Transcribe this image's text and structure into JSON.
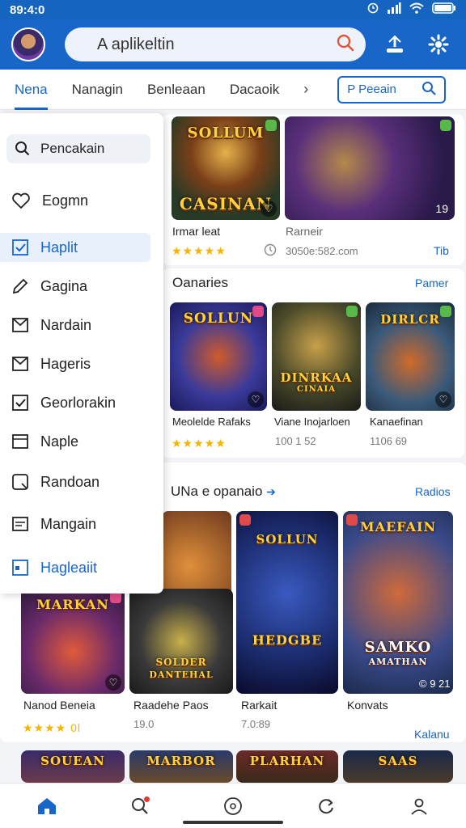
{
  "status": {
    "time": "89:4:0"
  },
  "header": {
    "search_text": "A aplikeltin"
  },
  "tabs": {
    "items": [
      "Nena",
      "Nanagin",
      "Benleaan",
      "Dacaoik"
    ],
    "more": "›",
    "search_label": "P Peeain"
  },
  "drawer": {
    "search": "Pencakain",
    "items": [
      {
        "label": "Eogmn",
        "icon": "heart-icon"
      },
      {
        "label": "Haplit",
        "icon": "checkbox-icon"
      },
      {
        "label": "Gagina",
        "icon": "pen-icon"
      },
      {
        "label": "Nardain",
        "icon": "mail-icon"
      },
      {
        "label": "Hageris",
        "icon": "mail-icon"
      },
      {
        "label": "Georlorakin",
        "icon": "checkbox-icon"
      },
      {
        "label": "Naple",
        "icon": "window-icon"
      },
      {
        "label": "Randoan",
        "icon": "refresh-icon"
      },
      {
        "label": "Mangain",
        "icon": "list-icon"
      },
      {
        "label": "Hagleaiit",
        "icon": "window-icon"
      }
    ]
  },
  "featured": {
    "cards": [
      {
        "art": "SOLLUM",
        "art2": "CASINAN",
        "title": "Irmar leat",
        "rating": "★★★★★"
      },
      {
        "art": "",
        "title": "Rarneir",
        "meta": "3050e:582.com",
        "rating_value": "19",
        "link": "Tib"
      }
    ]
  },
  "section1": {
    "title": "Oanaries",
    "link": "Pamer",
    "cards": [
      {
        "art": "SOLLUN",
        "title": "Meolelde Rafaks",
        "rating": "★★★★★"
      },
      {
        "art": "DINRKAA",
        "art2": "CINAIA",
        "title": "Viane Inojarloen",
        "meta": "100 1 52"
      },
      {
        "art": "DIRLCR",
        "title": "Kanaefinan",
        "meta": "1106 69"
      }
    ]
  },
  "section2": {
    "title": "UNa e opanaio",
    "arrow": "➔",
    "link": "Radios",
    "cards": [
      {
        "art": "MARKAN",
        "title": "Nanod Beneia",
        "rating": "★★★★ 0l"
      },
      {
        "art": "SOLDER",
        "art2": "DANTEHAL",
        "title": "Raadehe Paos",
        "meta": "19.0"
      },
      {
        "art": "SOLLUN",
        "art2": "HEDGBE",
        "title": "Rarkait",
        "meta": "7.0:89"
      },
      {
        "art": "MAEFAIN",
        "art2": "SAMKO",
        "art3": "AMATHAN",
        "title": "Konvats",
        "meta": "© 9 21"
      }
    ],
    "more_link": "Kalanu"
  },
  "row3": {
    "arts": [
      "SOUEAN",
      "MARBOR",
      "PLARHAN",
      "SAAS"
    ]
  },
  "bottom_nav": [
    "home-icon",
    "search-icon",
    "compass-icon",
    "refresh-icon",
    "profile-icon"
  ],
  "colors": {
    "primary": "#1766c8",
    "star": "#f4b400"
  }
}
